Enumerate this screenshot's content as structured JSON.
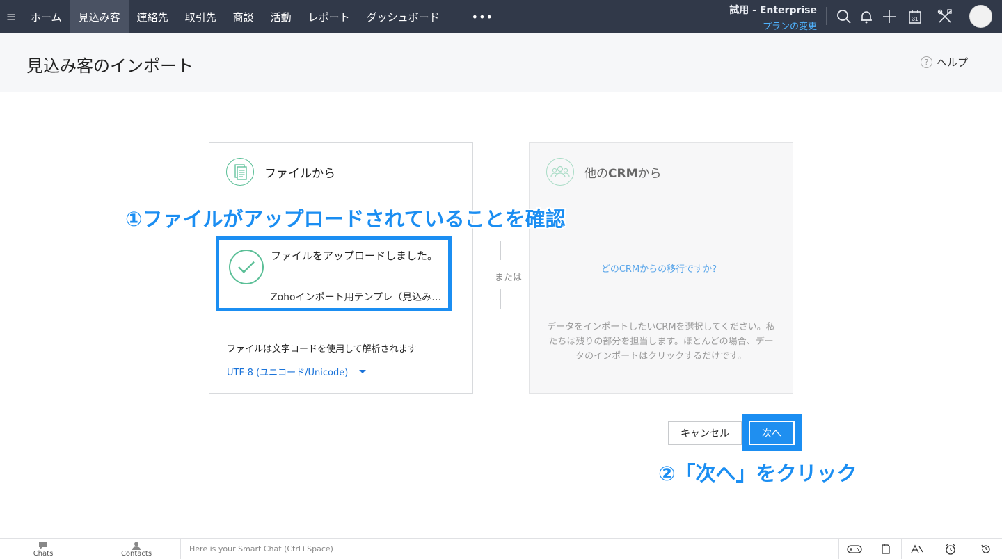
{
  "nav": {
    "items": [
      {
        "label": "ホーム",
        "active": false
      },
      {
        "label": "見込み客",
        "active": true
      },
      {
        "label": "連絡先",
        "active": false
      },
      {
        "label": "取引先",
        "active": false
      },
      {
        "label": "商談",
        "active": false
      },
      {
        "label": "活動",
        "active": false
      },
      {
        "label": "レポート",
        "active": false
      },
      {
        "label": "ダッシュボード",
        "active": false
      }
    ],
    "more": "•••",
    "edition": "試用 - Enterprise",
    "change_plan": "プランの変更",
    "calendar_day": "31"
  },
  "header": {
    "title": "見込み客のインポート",
    "help": "ヘルプ",
    "help_icon": "?"
  },
  "file_card": {
    "title": "ファイルから",
    "upload_message": "ファイルをアップロードしました。",
    "file_name": "Zohoインポート用テンプレ（見込み客）",
    "encoding_label": "ファイルは文字コードを使用して解析されます",
    "encoding_value": "UTF-8 (ユニコード/Unicode)"
  },
  "divider": {
    "or": "または"
  },
  "crm_card": {
    "title_prefix": "他の",
    "title_bold": "CRM",
    "title_suffix": "から",
    "link": "どのCRMからの移行ですか？",
    "description": "データをインポートしたいCRMを選択してください。私たちは残りの部分を担当します。ほとんどの場合、データのインポートはクリックするだけです。"
  },
  "actions": {
    "cancel": "キャンセル",
    "next": "次へ"
  },
  "annotations": {
    "step1": "①ファイルがアップロードされていることを確認",
    "step2": "②「次へ」をクリック"
  },
  "bottom": {
    "chats": "Chats",
    "contacts": "Contacts",
    "smart_chat_placeholder": "Here is your Smart Chat (Ctrl+Space)"
  },
  "colors": {
    "nav_bg": "#313949",
    "accent": "#1b8ef2",
    "success": "#5bbf97"
  }
}
